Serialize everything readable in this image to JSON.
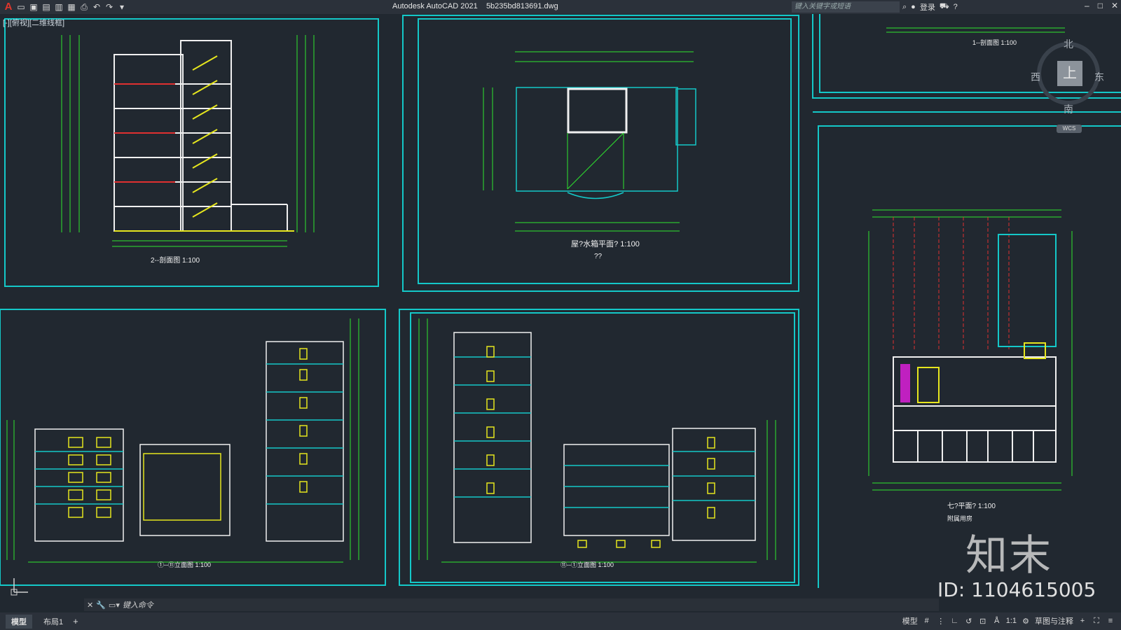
{
  "app": {
    "title": "Autodesk AutoCAD 2021",
    "filename": "5b235bd813691.dwg",
    "search_placeholder": "键入关键字或短语",
    "login": "登录",
    "view_label": "[-][俯视][二维线框]"
  },
  "compass": {
    "north": "北",
    "south": "南",
    "east": "东",
    "west": "西",
    "top": "上",
    "wcs": "WCS"
  },
  "drawings": {
    "section_2": "2--剖面图 1:100",
    "water_tank": "屋?水箱平面?   1:100",
    "water_tank_sub": "??",
    "section_1": "1--剖面图 1:100",
    "elev_a": "①--⑪立面图 1:100",
    "elev_b": "⑪--①立面图 1:100",
    "floor7": "七?平面?   1:100",
    "floor7_sub": "附属用房"
  },
  "cmdline": {
    "placeholder": "键入命令"
  },
  "tabs": [
    {
      "label": "模型"
    },
    {
      "label": "布局1"
    }
  ],
  "status": {
    "model": "模型",
    "scale": "1:1",
    "workspace": "草图与注释"
  },
  "watermark": {
    "logo": "知末",
    "id": "ID: 1104615005"
  },
  "colors": {
    "frame": "#14c8c8",
    "line": "#2ee62e",
    "yellow": "#e6e61e",
    "white": "#f0f0f0",
    "bg": "#212830"
  }
}
